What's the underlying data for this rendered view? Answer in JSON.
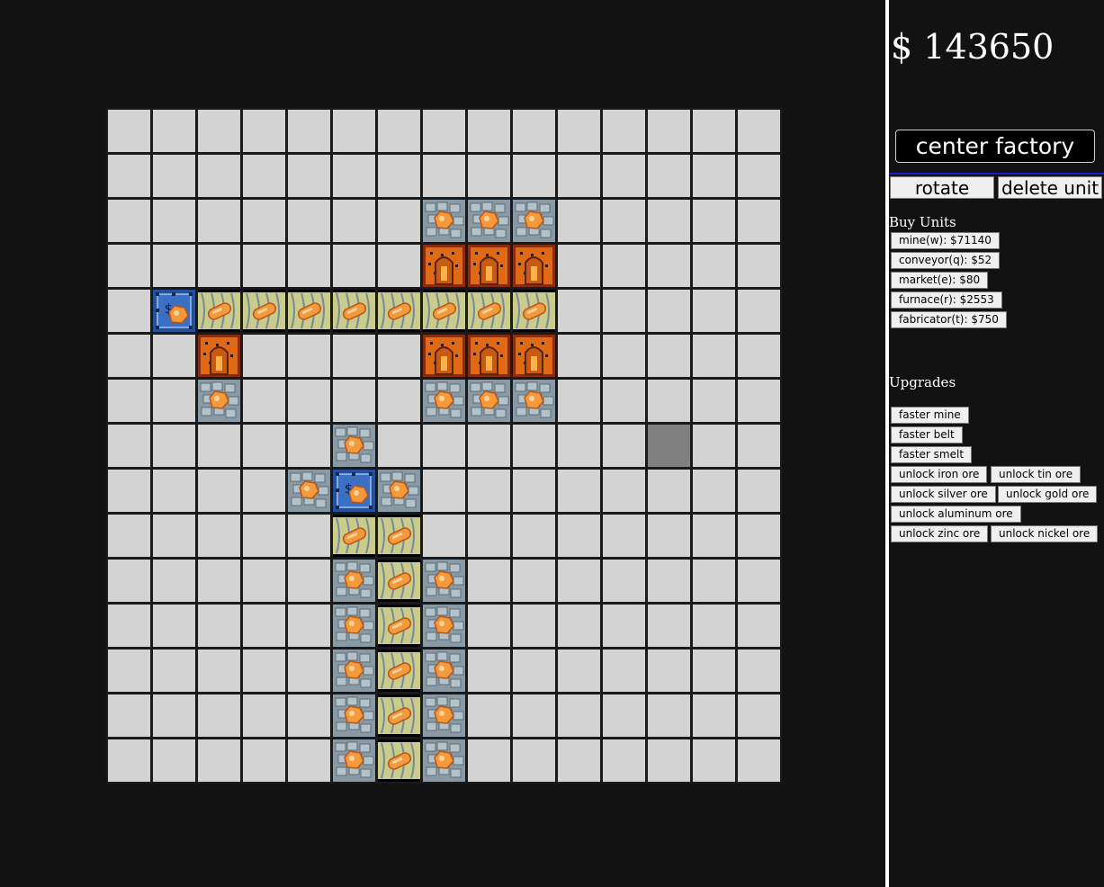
{
  "money": {
    "symbol": "$",
    "amount": "143650"
  },
  "controls": {
    "center_factory": "center factory",
    "rotate": "rotate",
    "delete_unit": "delete unit"
  },
  "buy_units": {
    "heading": "Buy Units",
    "items": [
      {
        "label": "mine(w): $71140"
      },
      {
        "label": "conveyor(q): $52"
      },
      {
        "label": "market(e): $80"
      },
      {
        "label": "furnace(r): $2553"
      },
      {
        "label": "fabricator(t): $750"
      }
    ]
  },
  "upgrades": {
    "heading": "Upgrades",
    "items": [
      {
        "label": "faster mine"
      },
      {
        "label": "faster belt"
      },
      {
        "label": "faster smelt"
      },
      {
        "label": "unlock iron ore"
      },
      {
        "label": "unlock tin ore"
      },
      {
        "label": "unlock silver ore"
      },
      {
        "label": "unlock gold ore"
      },
      {
        "label": "unlock aluminum ore"
      },
      {
        "label": "unlock zinc ore"
      },
      {
        "label": "unlock nickel ore"
      }
    ]
  },
  "grid": {
    "cols": 15,
    "rows": 15,
    "highlight_cell": [
      12,
      7
    ],
    "units": [
      {
        "type": "mine",
        "col": 7,
        "row": 2
      },
      {
        "type": "mine",
        "col": 8,
        "row": 2
      },
      {
        "type": "mine",
        "col": 9,
        "row": 2
      },
      {
        "type": "furnace",
        "col": 7,
        "row": 3
      },
      {
        "type": "furnace",
        "col": 8,
        "row": 3
      },
      {
        "type": "furnace",
        "col": 9,
        "row": 3
      },
      {
        "type": "market",
        "col": 1,
        "row": 4
      },
      {
        "type": "conveyor",
        "col": 2,
        "row": 4
      },
      {
        "type": "conveyor",
        "col": 3,
        "row": 4
      },
      {
        "type": "conveyor",
        "col": 4,
        "row": 4
      },
      {
        "type": "conveyor",
        "col": 5,
        "row": 4
      },
      {
        "type": "conveyor",
        "col": 6,
        "row": 4
      },
      {
        "type": "conveyor",
        "col": 7,
        "row": 4
      },
      {
        "type": "conveyor",
        "col": 8,
        "row": 4
      },
      {
        "type": "conveyor",
        "col": 9,
        "row": 4
      },
      {
        "type": "furnace",
        "col": 2,
        "row": 5
      },
      {
        "type": "furnace",
        "col": 7,
        "row": 5
      },
      {
        "type": "furnace",
        "col": 8,
        "row": 5
      },
      {
        "type": "furnace",
        "col": 9,
        "row": 5
      },
      {
        "type": "mine",
        "col": 2,
        "row": 6
      },
      {
        "type": "mine",
        "col": 7,
        "row": 6
      },
      {
        "type": "mine",
        "col": 8,
        "row": 6
      },
      {
        "type": "mine",
        "col": 9,
        "row": 6
      },
      {
        "type": "mine",
        "col": 5,
        "row": 7
      },
      {
        "type": "mine",
        "col": 4,
        "row": 8
      },
      {
        "type": "market",
        "col": 5,
        "row": 8
      },
      {
        "type": "mine",
        "col": 6,
        "row": 8
      },
      {
        "type": "conveyor",
        "col": 5,
        "row": 9
      },
      {
        "type": "conveyor",
        "col": 6,
        "row": 9
      },
      {
        "type": "mine",
        "col": 5,
        "row": 10
      },
      {
        "type": "conveyor",
        "col": 6,
        "row": 10
      },
      {
        "type": "mine",
        "col": 7,
        "row": 10
      },
      {
        "type": "mine",
        "col": 5,
        "row": 11
      },
      {
        "type": "conveyor",
        "col": 6,
        "row": 11
      },
      {
        "type": "mine",
        "col": 7,
        "row": 11
      },
      {
        "type": "mine",
        "col": 5,
        "row": 12
      },
      {
        "type": "conveyor",
        "col": 6,
        "row": 12
      },
      {
        "type": "mine",
        "col": 7,
        "row": 12
      },
      {
        "type": "mine",
        "col": 5,
        "row": 13
      },
      {
        "type": "conveyor",
        "col": 6,
        "row": 13
      },
      {
        "type": "mine",
        "col": 7,
        "row": 13
      },
      {
        "type": "mine",
        "col": 5,
        "row": 14
      },
      {
        "type": "conveyor",
        "col": 6,
        "row": 14
      },
      {
        "type": "mine",
        "col": 7,
        "row": 14
      }
    ]
  },
  "colors": {
    "board_bg": "#121212",
    "cell": "#d3d3d3",
    "highlight": "#808080",
    "ore": "#f39a3c",
    "conveyor": "#c9cc8a",
    "furnace": "#e06a14",
    "mine": "#8a9aa5",
    "market": "#3a6fc4"
  }
}
